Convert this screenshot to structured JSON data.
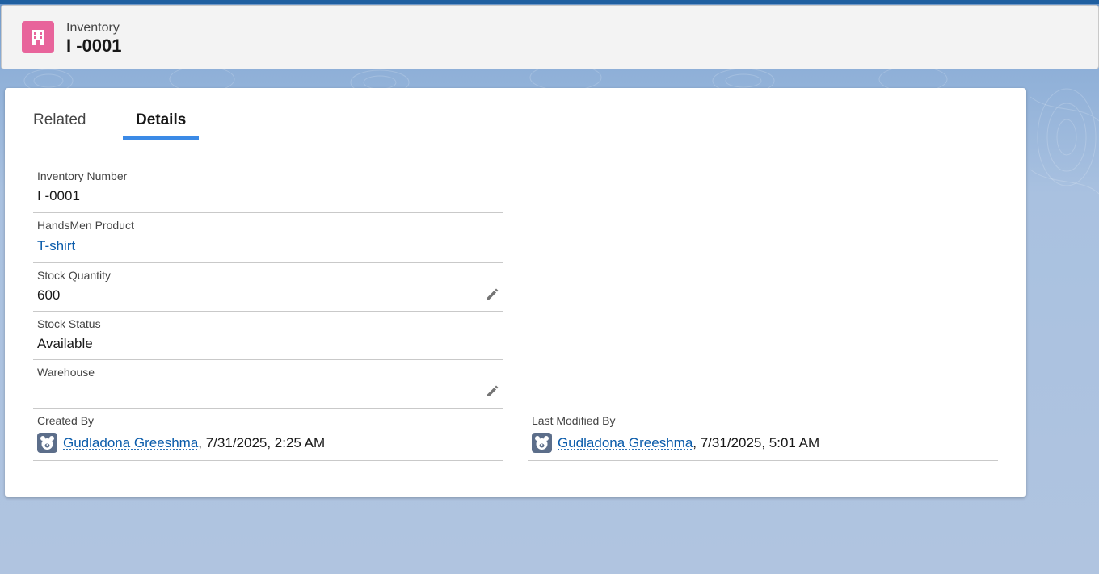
{
  "header": {
    "object_type": "Inventory",
    "record_name": "I -0001",
    "object_icon": "building-icon",
    "icon_color": "#e8649b"
  },
  "tabs": [
    {
      "label": "Related",
      "active": false
    },
    {
      "label": "Details",
      "active": true
    }
  ],
  "fields": {
    "inventory_number": {
      "label": "Inventory Number",
      "value": "I -0001"
    },
    "handsmen_product": {
      "label": "HandsMen Product",
      "value": "T-shirt"
    },
    "stock_quantity": {
      "label": "Stock Quantity",
      "value": "600"
    },
    "stock_status": {
      "label": "Stock Status",
      "value": "Available"
    },
    "warehouse": {
      "label": "Warehouse",
      "value": ""
    },
    "created_by": {
      "label": "Created By",
      "user": "Gudladona Greeshma",
      "timestamp": ", 7/31/2025, 2:25 AM"
    },
    "last_modified_by": {
      "label": "Last Modified By",
      "user": "Gudladona Greeshma",
      "timestamp": ", 7/31/2025, 5:01 AM"
    }
  },
  "colors": {
    "accent": "#3b8ae6",
    "link": "#0b5cab"
  }
}
